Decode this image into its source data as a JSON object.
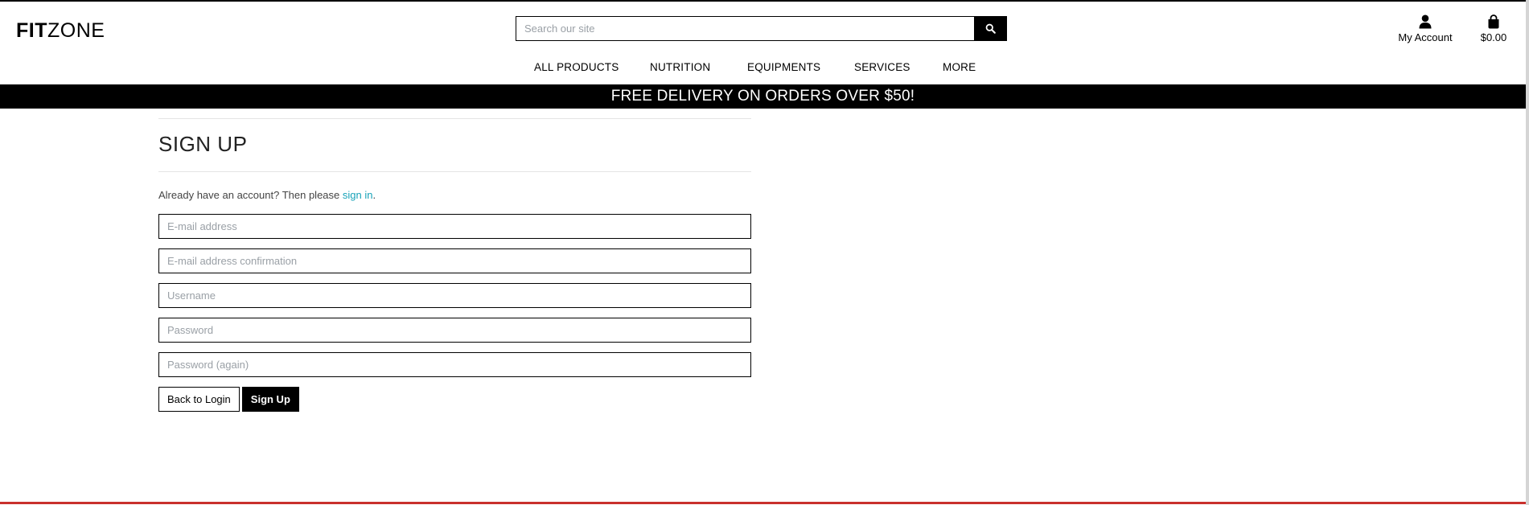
{
  "header": {
    "logo_bold": "FIT",
    "logo_rest": "ZONE",
    "search_placeholder": "Search our site",
    "account_label": "My Account",
    "cart_total": "$0.00"
  },
  "nav": {
    "items": [
      {
        "label": "ALL PRODUCTS"
      },
      {
        "label": "NUTRITION"
      },
      {
        "label": "EQUIPMENTS"
      },
      {
        "label": "SERVICES"
      },
      {
        "label": "MORE"
      }
    ]
  },
  "banner": {
    "text": "FREE DELIVERY ON ORDERS OVER $50!"
  },
  "signup": {
    "title": "SIGN UP",
    "intro_text": "Already have an account? Then please ",
    "intro_link": "sign in",
    "intro_end": ".",
    "fields": {
      "email_placeholder": "E-mail address",
      "email_confirm_placeholder": "E-mail address confirmation",
      "username_placeholder": "Username",
      "password_placeholder": "Password",
      "password_again_placeholder": "Password (again)"
    },
    "back_label": "Back to Login",
    "submit_label": "Sign Up"
  },
  "colors": {
    "brand": "#000000",
    "link": "#17a2b8",
    "accent_line": "#c9302c"
  },
  "icons": {
    "search": "search-icon",
    "account": "user-icon",
    "cart": "shopping-bag-icon"
  }
}
